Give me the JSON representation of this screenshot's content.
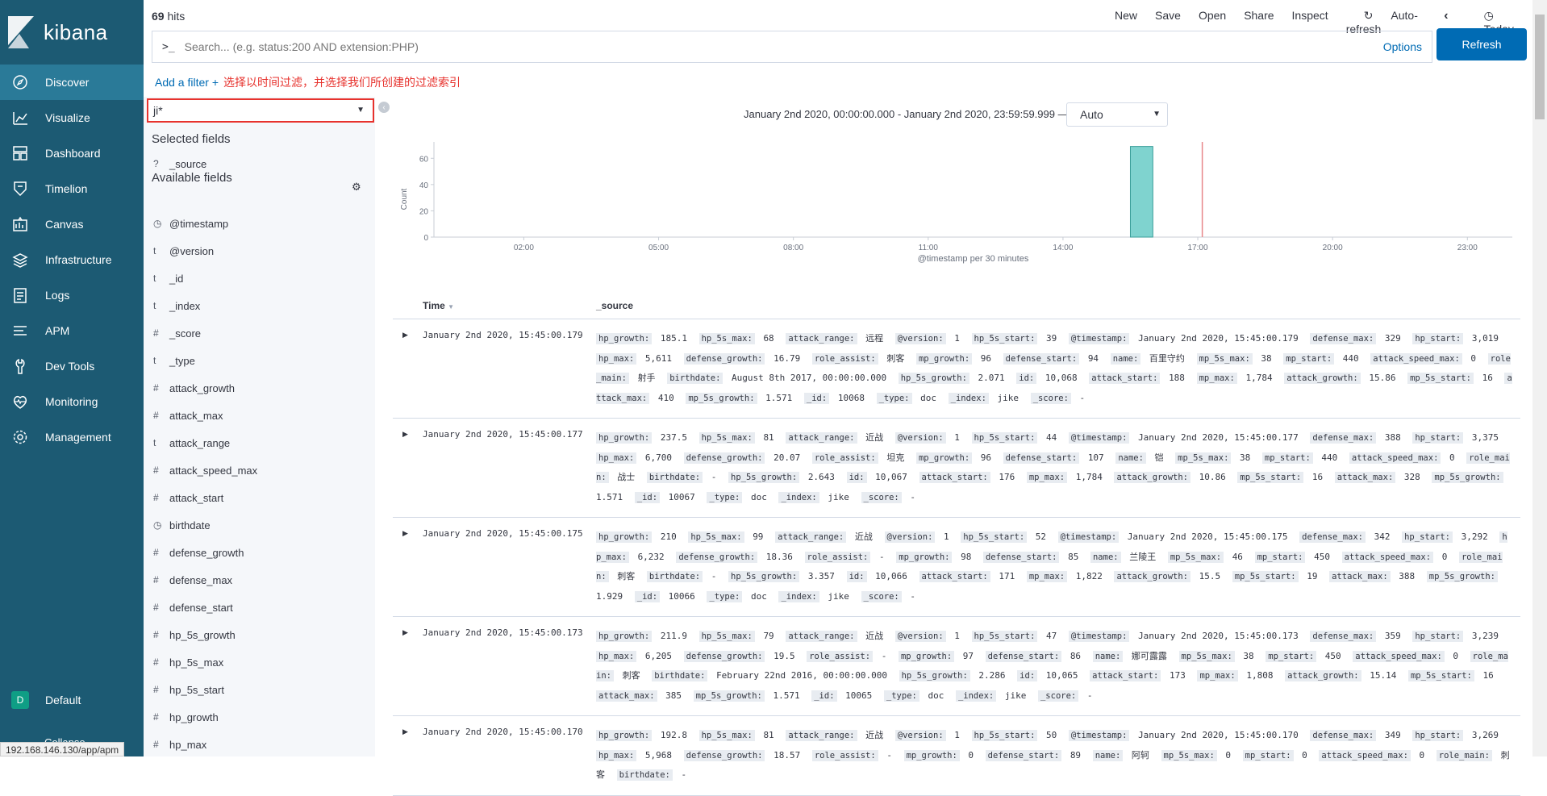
{
  "app": {
    "brand": "kibana"
  },
  "nav": [
    {
      "label": "Discover",
      "icon": "compass-icon",
      "active": true
    },
    {
      "label": "Visualize",
      "icon": "visualize-icon"
    },
    {
      "label": "Dashboard",
      "icon": "dashboard-icon"
    },
    {
      "label": "Timelion",
      "icon": "timelion-icon"
    },
    {
      "label": "Canvas",
      "icon": "canvas-icon"
    },
    {
      "label": "Infrastructure",
      "icon": "infrastructure-icon"
    },
    {
      "label": "Logs",
      "icon": "logs-icon"
    },
    {
      "label": "APM",
      "icon": "apm-icon"
    },
    {
      "label": "Dev Tools",
      "icon": "wrench-icon"
    },
    {
      "label": "Monitoring",
      "icon": "heartbeat-icon"
    },
    {
      "label": "Management",
      "icon": "gear-icon"
    }
  ],
  "space": {
    "avatar": "D",
    "label": "Default"
  },
  "collapse_label": "Collapse",
  "status_url": "192.168.146.130/app/apm",
  "top": {
    "hits_count": "69",
    "hits_label": "hits",
    "menu": [
      "New",
      "Save",
      "Open",
      "Share",
      "Inspect"
    ],
    "auto_refresh": "Auto-refresh",
    "today": "Today"
  },
  "search": {
    "prompt": ">_",
    "placeholder": "Search... (e.g. status:200 AND extension:PHP)",
    "options": "Options",
    "refresh": "Refresh"
  },
  "filter": {
    "add_filter": "Add a filter",
    "annotation": "选择以时间过滤，并选择我们所创建的过滤索引"
  },
  "index_pattern": "ji*",
  "sidebar_fields": {
    "selected_title": "Selected fields",
    "selected": [
      {
        "type": "?",
        "name": "_source"
      }
    ],
    "available_title": "Available fields",
    "available": [
      {
        "type": "clock",
        "name": "@timestamp"
      },
      {
        "type": "t",
        "name": "@version"
      },
      {
        "type": "t",
        "name": "_id"
      },
      {
        "type": "t",
        "name": "_index"
      },
      {
        "type": "#",
        "name": "_score"
      },
      {
        "type": "t",
        "name": "_type"
      },
      {
        "type": "#",
        "name": "attack_growth"
      },
      {
        "type": "#",
        "name": "attack_max"
      },
      {
        "type": "t",
        "name": "attack_range"
      },
      {
        "type": "#",
        "name": "attack_speed_max"
      },
      {
        "type": "#",
        "name": "attack_start"
      },
      {
        "type": "clock",
        "name": "birthdate"
      },
      {
        "type": "#",
        "name": "defense_growth"
      },
      {
        "type": "#",
        "name": "defense_max"
      },
      {
        "type": "#",
        "name": "defense_start"
      },
      {
        "type": "#",
        "name": "hp_5s_growth"
      },
      {
        "type": "#",
        "name": "hp_5s_max"
      },
      {
        "type": "#",
        "name": "hp_5s_start"
      },
      {
        "type": "#",
        "name": "hp_growth"
      },
      {
        "type": "#",
        "name": "hp_max"
      }
    ]
  },
  "histogram": {
    "range": "January 2nd 2020, 00:00:00.000 - January 2nd 2020, 23:59:59.999 —",
    "interval": "Auto",
    "colors": {
      "bar": "#7fd3cf",
      "bar_edge": "#3a9e99",
      "now_line": "#e7878a",
      "axis": "#c9ced6"
    }
  },
  "chart_data": {
    "type": "bar",
    "xlabel": "@timestamp per 30 minutes",
    "ylabel": "Count",
    "x_ticks": [
      "02:00",
      "05:00",
      "08:00",
      "11:00",
      "14:00",
      "17:00",
      "20:00",
      "23:00"
    ],
    "y_ticks": [
      0,
      20,
      40,
      60
    ],
    "ylim": [
      0,
      70
    ],
    "xlim_hours": [
      0,
      24
    ],
    "bars": [
      {
        "x_hours": 15.5,
        "width_hours": 0.5,
        "value": 69
      }
    ],
    "now_marker_hours": 17.1
  },
  "table": {
    "col_time": "Time",
    "col_source": "_source",
    "rows": [
      {
        "time": "January 2nd 2020, 15:45:00.179",
        "fields": [
          [
            "hp_growth:",
            "185.1"
          ],
          [
            "hp_5s_max:",
            "68"
          ],
          [
            "attack_range:",
            "远程"
          ],
          [
            "@version:",
            "1"
          ],
          [
            "hp_5s_start:",
            "39"
          ],
          [
            "@timestamp:",
            "January 2nd 2020, 15:45:00.179"
          ],
          [
            "defense_max:",
            "329"
          ],
          [
            "hp_start:",
            "3,019"
          ],
          [
            "hp_max:",
            "5,611"
          ],
          [
            "defense_growth:",
            "16.79"
          ],
          [
            "role_assist:",
            "刺客"
          ],
          [
            "mp_growth:",
            "96"
          ],
          [
            "defense_start:",
            "94"
          ],
          [
            "name:",
            "百里守约"
          ],
          [
            "mp_5s_max:",
            "38"
          ],
          [
            "mp_start:",
            "440"
          ],
          [
            "attack_speed_max:",
            "0"
          ],
          [
            "role_main:",
            "射手"
          ],
          [
            "birthdate:",
            "August 8th 2017, 00:00:00.000"
          ],
          [
            "hp_5s_growth:",
            "2.071"
          ],
          [
            "id:",
            "10,068"
          ],
          [
            "attack_start:",
            "188"
          ],
          [
            "mp_max:",
            "1,784"
          ],
          [
            "attack_growth:",
            "15.86"
          ],
          [
            "mp_5s_start:",
            "16"
          ],
          [
            "attack_max:",
            "410"
          ],
          [
            "mp_5s_growth:",
            "1.571"
          ],
          [
            "_id:",
            "10068"
          ],
          [
            "_type:",
            "doc"
          ],
          [
            "_index:",
            "jike"
          ],
          [
            "_score:",
            "-"
          ]
        ]
      },
      {
        "time": "January 2nd 2020, 15:45:00.177",
        "fields": [
          [
            "hp_growth:",
            "237.5"
          ],
          [
            "hp_5s_max:",
            "81"
          ],
          [
            "attack_range:",
            "近战"
          ],
          [
            "@version:",
            "1"
          ],
          [
            "hp_5s_start:",
            "44"
          ],
          [
            "@timestamp:",
            "January 2nd 2020, 15:45:00.177"
          ],
          [
            "defense_max:",
            "388"
          ],
          [
            "hp_start:",
            "3,375"
          ],
          [
            "hp_max:",
            "6,700"
          ],
          [
            "defense_growth:",
            "20.07"
          ],
          [
            "role_assist:",
            "坦克"
          ],
          [
            "mp_growth:",
            "96"
          ],
          [
            "defense_start:",
            "107"
          ],
          [
            "name:",
            "铠"
          ],
          [
            "mp_5s_max:",
            "38"
          ],
          [
            "mp_start:",
            "440"
          ],
          [
            "attack_speed_max:",
            "0"
          ],
          [
            "role_main:",
            "战士"
          ],
          [
            "birthdate:",
            "-"
          ],
          [
            "hp_5s_growth:",
            "2.643"
          ],
          [
            "id:",
            "10,067"
          ],
          [
            "attack_start:",
            "176"
          ],
          [
            "mp_max:",
            "1,784"
          ],
          [
            "attack_growth:",
            "10.86"
          ],
          [
            "mp_5s_start:",
            "16"
          ],
          [
            "attack_max:",
            "328"
          ],
          [
            "mp_5s_growth:",
            "1.571"
          ],
          [
            "_id:",
            "10067"
          ],
          [
            "_type:",
            "doc"
          ],
          [
            "_index:",
            "jike"
          ],
          [
            "_score:",
            "-"
          ]
        ]
      },
      {
        "time": "January 2nd 2020, 15:45:00.175",
        "fields": [
          [
            "hp_growth:",
            "210"
          ],
          [
            "hp_5s_max:",
            "99"
          ],
          [
            "attack_range:",
            "近战"
          ],
          [
            "@version:",
            "1"
          ],
          [
            "hp_5s_start:",
            "52"
          ],
          [
            "@timestamp:",
            "January 2nd 2020, 15:45:00.175"
          ],
          [
            "defense_max:",
            "342"
          ],
          [
            "hp_start:",
            "3,292"
          ],
          [
            "hp_max:",
            "6,232"
          ],
          [
            "defense_growth:",
            "18.36"
          ],
          [
            "role_assist:",
            "-"
          ],
          [
            "mp_growth:",
            "98"
          ],
          [
            "defense_start:",
            "85"
          ],
          [
            "name:",
            "兰陵王"
          ],
          [
            "mp_5s_max:",
            "46"
          ],
          [
            "mp_start:",
            "450"
          ],
          [
            "attack_speed_max:",
            "0"
          ],
          [
            "role_main:",
            "刺客"
          ],
          [
            "birthdate:",
            "-"
          ],
          [
            "hp_5s_growth:",
            "3.357"
          ],
          [
            "id:",
            "10,066"
          ],
          [
            "attack_start:",
            "171"
          ],
          [
            "mp_max:",
            "1,822"
          ],
          [
            "attack_growth:",
            "15.5"
          ],
          [
            "mp_5s_start:",
            "19"
          ],
          [
            "attack_max:",
            "388"
          ],
          [
            "mp_5s_growth:",
            "1.929"
          ],
          [
            "_id:",
            "10066"
          ],
          [
            "_type:",
            "doc"
          ],
          [
            "_index:",
            "jike"
          ],
          [
            "_score:",
            "-"
          ]
        ]
      },
      {
        "time": "January 2nd 2020, 15:45:00.173",
        "fields": [
          [
            "hp_growth:",
            "211.9"
          ],
          [
            "hp_5s_max:",
            "79"
          ],
          [
            "attack_range:",
            "近战"
          ],
          [
            "@version:",
            "1"
          ],
          [
            "hp_5s_start:",
            "47"
          ],
          [
            "@timestamp:",
            "January 2nd 2020, 15:45:00.173"
          ],
          [
            "defense_max:",
            "359"
          ],
          [
            "hp_start:",
            "3,239"
          ],
          [
            "hp_max:",
            "6,205"
          ],
          [
            "defense_growth:",
            "19.5"
          ],
          [
            "role_assist:",
            "-"
          ],
          [
            "mp_growth:",
            "97"
          ],
          [
            "defense_start:",
            "86"
          ],
          [
            "name:",
            "娜可露露"
          ],
          [
            "mp_5s_max:",
            "38"
          ],
          [
            "mp_start:",
            "450"
          ],
          [
            "attack_speed_max:",
            "0"
          ],
          [
            "role_main:",
            "刺客"
          ],
          [
            "birthdate:",
            "February 22nd 2016, 00:00:00.000"
          ],
          [
            "hp_5s_growth:",
            "2.286"
          ],
          [
            "id:",
            "10,065"
          ],
          [
            "attack_start:",
            "173"
          ],
          [
            "mp_max:",
            "1,808"
          ],
          [
            "attack_growth:",
            "15.14"
          ],
          [
            "mp_5s_start:",
            "16"
          ],
          [
            "attack_max:",
            "385"
          ],
          [
            "mp_5s_growth:",
            "1.571"
          ],
          [
            "_id:",
            "10065"
          ],
          [
            "_type:",
            "doc"
          ],
          [
            "_index:",
            "jike"
          ],
          [
            "_score:",
            "-"
          ]
        ]
      },
      {
        "time": "January 2nd 2020, 15:45:00.170",
        "fields": [
          [
            "hp_growth:",
            "192.8"
          ],
          [
            "hp_5s_max:",
            "81"
          ],
          [
            "attack_range:",
            "近战"
          ],
          [
            "@version:",
            "1"
          ],
          [
            "hp_5s_start:",
            "50"
          ],
          [
            "@timestamp:",
            "January 2nd 2020, 15:45:00.170"
          ],
          [
            "defense_max:",
            "349"
          ],
          [
            "hp_start:",
            "3,269"
          ],
          [
            "hp_max:",
            "5,968"
          ],
          [
            "defense_growth:",
            "18.57"
          ],
          [
            "role_assist:",
            "-"
          ],
          [
            "mp_growth:",
            "0"
          ],
          [
            "defense_start:",
            "89"
          ],
          [
            "name:",
            "阿轲"
          ],
          [
            "mp_5s_max:",
            "0"
          ],
          [
            "mp_start:",
            "0"
          ],
          [
            "attack_speed_max:",
            "0"
          ],
          [
            "role_main:",
            "刺客"
          ],
          [
            "birthdate:",
            "-"
          ]
        ]
      }
    ]
  }
}
